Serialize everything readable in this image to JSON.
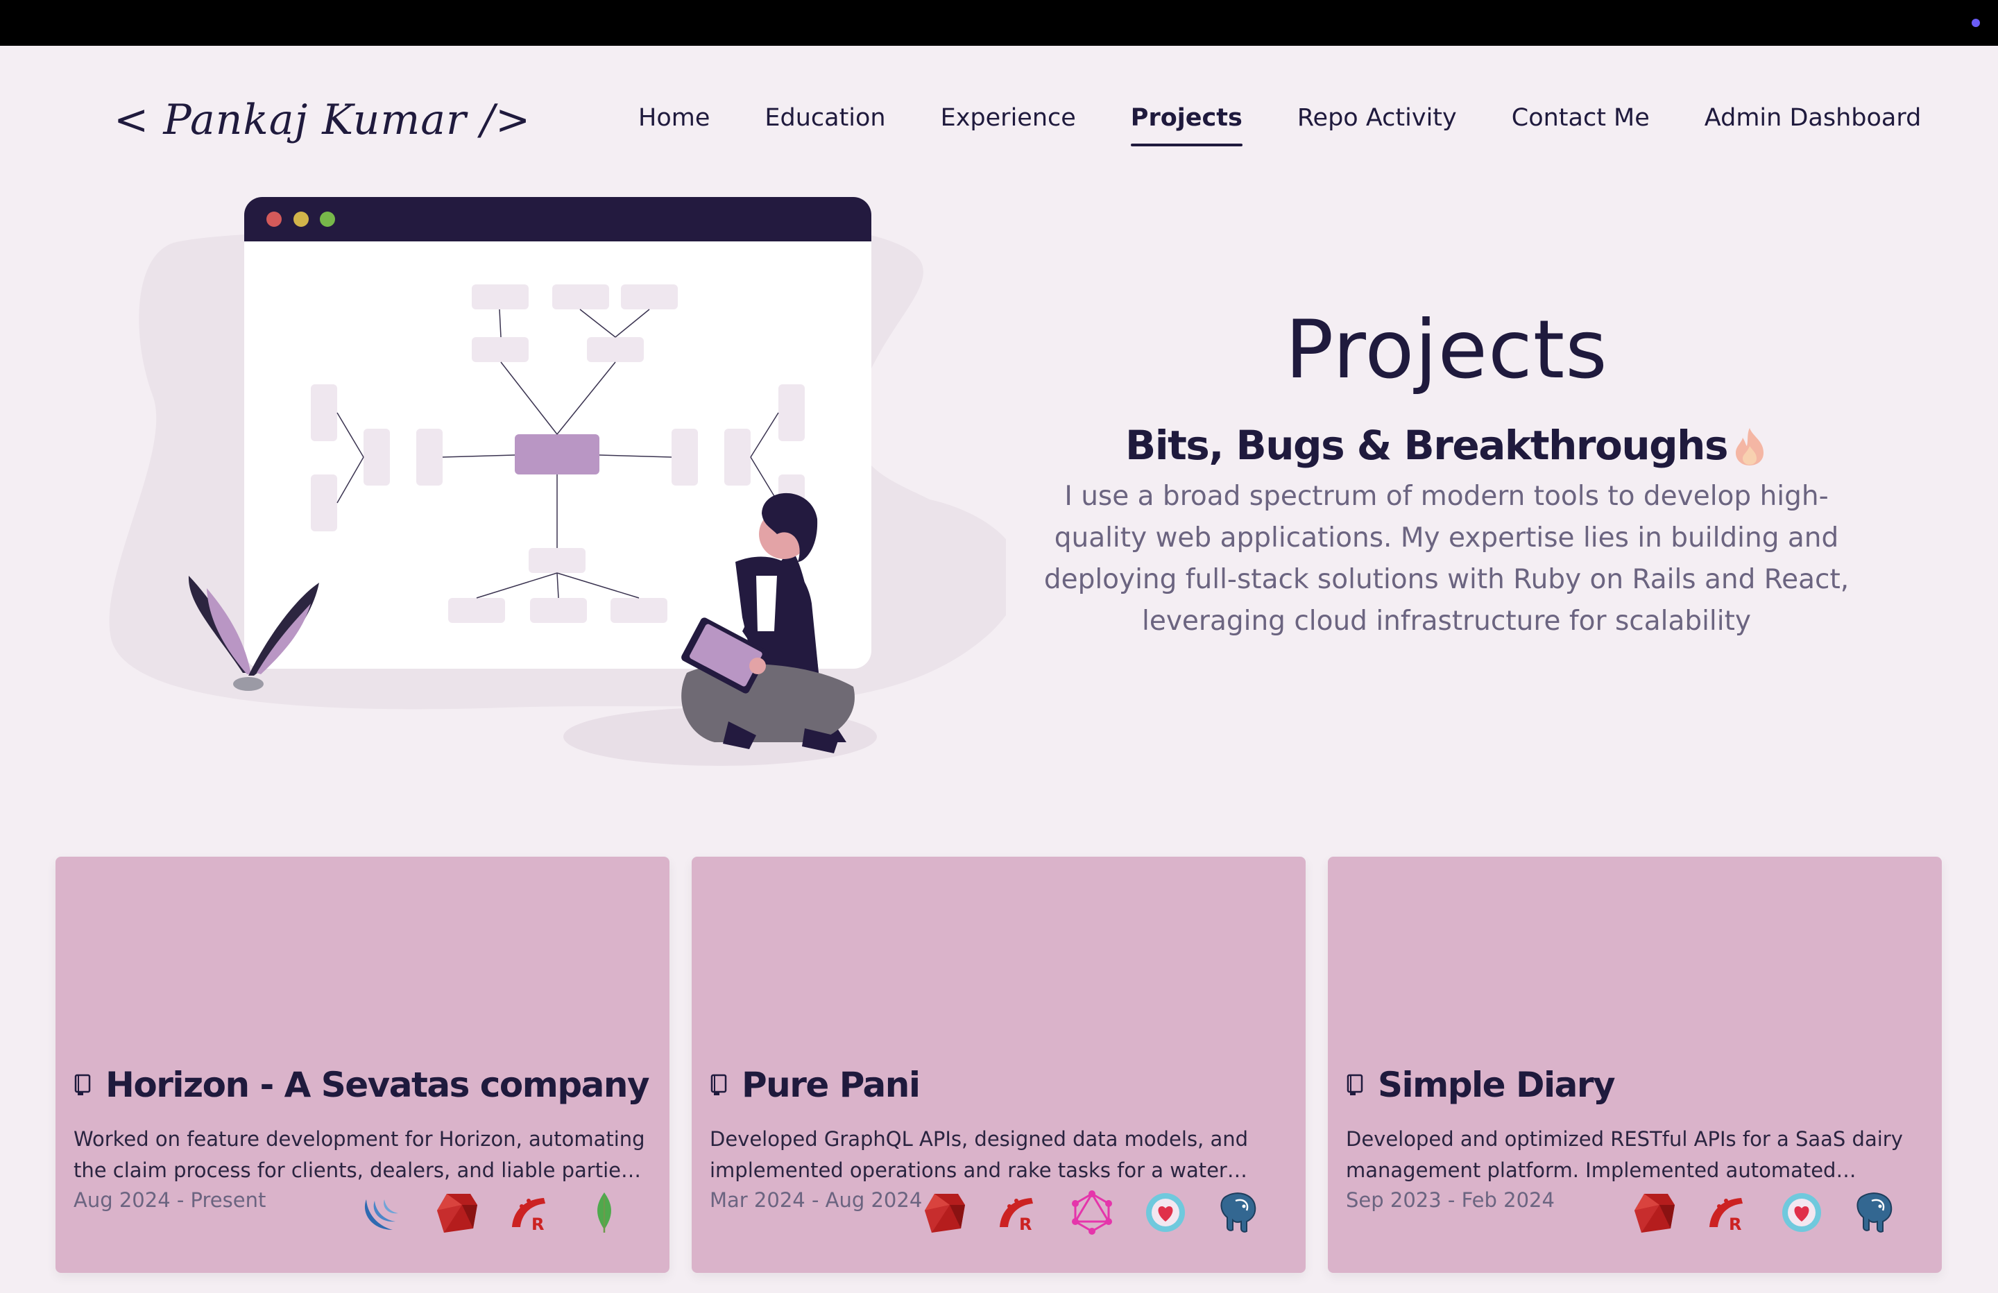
{
  "logo": {
    "text": "< Pankaj Kumar />"
  },
  "nav": [
    {
      "label": "Home",
      "active": false
    },
    {
      "label": "Education",
      "active": false
    },
    {
      "label": "Experience",
      "active": false
    },
    {
      "label": "Projects",
      "active": true
    },
    {
      "label": "Repo Activity",
      "active": false
    },
    {
      "label": "Contact Me",
      "active": false
    },
    {
      "label": "Admin Dashboard",
      "active": false
    }
  ],
  "hero": {
    "title": "Projects",
    "subtitle": "Bits, Bugs & Breakthroughs",
    "subtitle_icon": "fire-icon",
    "description": "I use a broad spectrum of modern tools to develop high-quality web applications. My expertise lies in building and deploying full-stack solutions with Ruby on Rails and React, leveraging cloud infrastructure for scalability"
  },
  "projects": [
    {
      "title": "Horizon - A Sevatas company",
      "description": "Worked on feature development for Horizon, automating the claim process for clients, dealers, and liable parties for...",
      "date": "Aug 2024 - Present",
      "tech_icons": [
        "jquery-icon",
        "ruby-icon",
        "rails-icon",
        "mongodb-icon"
      ]
    },
    {
      "title": "Pure Pani",
      "description": "Developed GraphQL APIs, designed data models, and implemented operations and rake tasks for a water delivery...",
      "date": "Mar 2024 - Aug 2024",
      "tech_icons": [
        "ruby-icon",
        "rails-icon",
        "graphql-icon",
        "rspec-icon",
        "postgresql-icon"
      ]
    },
    {
      "title": "Simple Diary",
      "description": "Developed and optimized RESTful APIs for a SaaS dairy management platform. Implemented automated invoicing,...",
      "date": "Sep 2023 - Feb 2024",
      "tech_icons": [
        "ruby-icon",
        "rails-icon",
        "rspec-icon",
        "postgresql-icon"
      ]
    }
  ],
  "colors": {
    "background": "#f4eef3",
    "card": "#dab3ca",
    "text": "#1f1a3d",
    "accent": "#6b5cf6"
  }
}
